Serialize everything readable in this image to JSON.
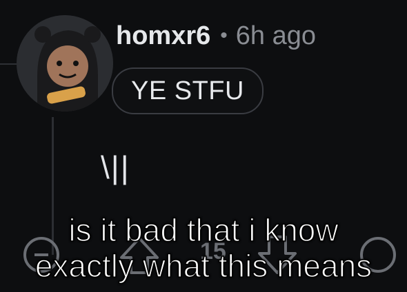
{
  "comment": {
    "username": "homxr6",
    "separator": "•",
    "time": "6h ago",
    "flair": "YE STFU",
    "body": "\\||",
    "vote_count": "15"
  },
  "caption": {
    "line1": "is it bad that i know",
    "line2": "exactly what this means"
  },
  "icons": [
    "avatar",
    "upvote-icon",
    "downvote-icon",
    "more-icon"
  ]
}
